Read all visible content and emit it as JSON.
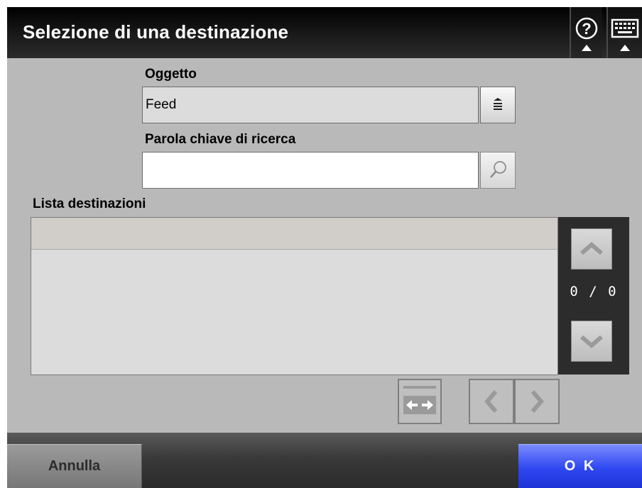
{
  "header": {
    "title": "Selezione di una destinazione",
    "help_icon": "question-circle-icon",
    "keyboard_icon": "keyboard-icon"
  },
  "form": {
    "object_label": "Oggetto",
    "object_value": "Feed",
    "keyword_label": "Parola chiave di ricerca",
    "keyword_value": ""
  },
  "list": {
    "label": "Lista destinazioni",
    "items": [],
    "page_indicator": "0 / 0"
  },
  "footer": {
    "cancel_label": "Annulla",
    "ok_label": "O K"
  },
  "colors": {
    "background": "#b9b9b9",
    "header": "#000000",
    "ok_button": "#2f47f0",
    "cancel_button": "#8a8a8a"
  }
}
